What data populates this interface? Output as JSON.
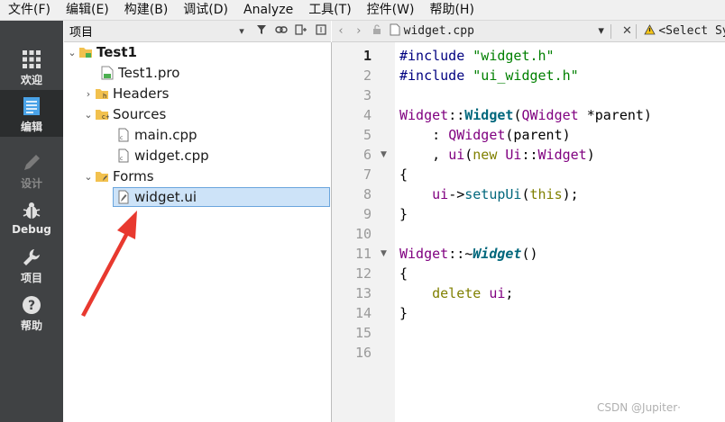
{
  "menu": [
    "文件(F)",
    "编辑(E)",
    "构建(B)",
    "调试(D)",
    "Analyze",
    "工具(T)",
    "控件(W)",
    "帮助(H)"
  ],
  "modes": [
    {
      "label": "欢迎",
      "icon": "grid-icon"
    },
    {
      "label": "编辑",
      "icon": "document-icon"
    },
    {
      "label": "设计",
      "icon": "pencil-icon"
    },
    {
      "label": "Debug",
      "icon": "bug-icon"
    },
    {
      "label": "项目",
      "icon": "wrench-icon"
    },
    {
      "label": "帮助",
      "icon": "help-icon"
    }
  ],
  "project_panel": {
    "title": "项目"
  },
  "tree": {
    "root": "Test1",
    "pro": "Test1.pro",
    "headers": "Headers",
    "sources": "Sources",
    "main_cpp": "main.cpp",
    "widget_cpp": "widget.cpp",
    "forms": "Forms",
    "widget_ui": "widget.ui"
  },
  "editor": {
    "file": "widget.cpp",
    "symbol": "<Select Symbol>",
    "line_numbers": [
      "1",
      "2",
      "3",
      "4",
      "5",
      "6",
      "7",
      "8",
      "9",
      "10",
      "11",
      "12",
      "13",
      "14",
      "15",
      "16"
    ],
    "current_line": "1"
  },
  "watermark": "CSDN @Jupiter·"
}
